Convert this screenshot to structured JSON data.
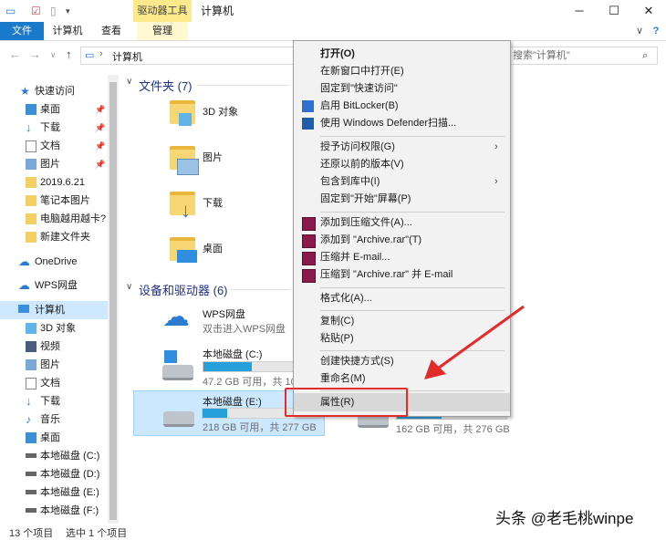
{
  "titlebar": {
    "context_tab": "驱动器工具",
    "title": "计算机",
    "minimize": "─",
    "maximize": "☐",
    "close": "✕"
  },
  "ribbon": {
    "tabs": [
      "文件",
      "计算机",
      "查看",
      "管理"
    ],
    "collapse": "∨",
    "help": "?"
  },
  "address": {
    "path": "计算机",
    "search_placeholder": "搜索\"计算机\""
  },
  "sidebar": {
    "quick_access": "快速访问",
    "quick_items": [
      "桌面",
      "下载",
      "文档",
      "图片",
      "2019.6.21",
      "笔记本图片",
      "电脑越用越卡?",
      "新建文件夹"
    ],
    "onedrive": "OneDrive",
    "wps": "WPS网盘",
    "computer": "计算机",
    "computer_items": [
      "3D 对象",
      "视频",
      "图片",
      "文档",
      "下载",
      "音乐",
      "桌面",
      "本地磁盘 (C:)",
      "本地磁盘 (D:)",
      "本地磁盘 (E:)",
      "本地磁盘 (F:)"
    ]
  },
  "main": {
    "folders_header": "文件夹 (7)",
    "folders": [
      "3D 对象",
      "图片",
      "下载",
      "桌面"
    ],
    "devices_header": "设备和驱动器 (6)",
    "wps_name": "WPS网盘",
    "wps_sub": "双击进入WPS网盘",
    "drive_c": {
      "name": "本地磁盘 (C:)",
      "free": "47.2 GB 可用，共 100",
      "used_fraction": 0.53
    },
    "drive_e": {
      "name": "本地磁盘 (E:)",
      "free": "218 GB 可用，共 277 GB",
      "used_fraction": 0.21
    },
    "drive_f": {
      "free": "162 GB 可用，共 276 GB",
      "used_fraction": 0.41
    }
  },
  "context_menu": {
    "open": "打开(O)",
    "open_new": "在新窗口中打开(E)",
    "pin_quick": "固定到\"快速访问\"",
    "bitlocker": "启用 BitLocker(B)",
    "defender": "使用 Windows Defender扫描...",
    "grant": "授予访问权限(G)",
    "restore": "还原以前的版本(V)",
    "include": "包含到库中(I)",
    "pin_start": "固定到\"开始\"屏幕(P)",
    "rar_add": "添加到压缩文件(A)...",
    "rar_add_archive": "添加到 \"Archive.rar\"(T)",
    "rar_email": "压缩并 E-mail...",
    "rar_archive_email": "压缩到 \"Archive.rar\" 并 E-mail",
    "format": "格式化(A)...",
    "copy": "复制(C)",
    "paste": "粘贴(P)",
    "shortcut": "创建快捷方式(S)",
    "rename": "重命名(M)",
    "properties": "属性(R)"
  },
  "status": {
    "count": "13 个项目",
    "selected": "选中 1 个项目"
  },
  "watermark": "头条 @老毛桃winpe",
  "colors": {
    "accent": "#1979ca",
    "annotation": "#e22b2b",
    "selection": "#cce8ff"
  }
}
